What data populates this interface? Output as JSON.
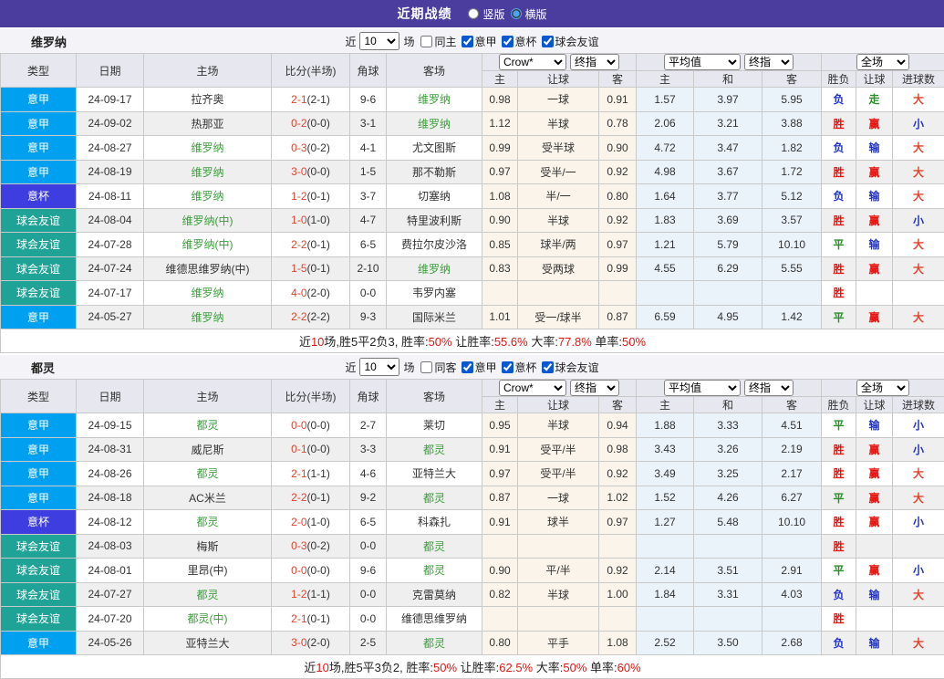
{
  "topbar": {
    "title": "近期战绩",
    "view_options": [
      {
        "label": "竖版",
        "selected": false
      },
      {
        "label": "横版",
        "selected": true
      }
    ]
  },
  "table_header": {
    "left_cols": [
      "类型",
      "日期",
      "主场",
      "比分(半场)",
      "角球",
      "客场"
    ],
    "odds_group_selects": [
      "Crow*",
      "终指"
    ],
    "avg_group_selects": [
      "平均值",
      "终指"
    ],
    "result_group_select": "全场",
    "sub_cols": [
      "主",
      "让球",
      "客",
      "主",
      "和",
      "客",
      "胜负",
      "让球",
      "进球数"
    ]
  },
  "colors": {
    "topbar_bg": "#4a3d9e",
    "header_bg": "#e7e7f0",
    "row_alt_bg": "#efefef",
    "odds_bg": "#fbf4ea",
    "avg_bg": "#eaf2fa",
    "team_highlight": "#3a9e3a",
    "score_red": "#e0442e",
    "league": {
      "意甲": "#00a0f0",
      "意杯": "#3e3ee0",
      "球会友谊": "#1fa396"
    },
    "outcome": {
      "胜": "#e8130f",
      "平": "#2e8b2e",
      "负": "#2233cc"
    },
    "handicap": {
      "赢": "#e8130f",
      "走": "#2e8b2e",
      "输": "#2233cc"
    },
    "goals": {
      "大": "#e0442e",
      "小": "#2233cc"
    }
  },
  "sections": [
    {
      "team": "维罗纳",
      "filter": {
        "prefix": "近",
        "count": "10",
        "suffix": "场",
        "same_venue": {
          "label": "同主",
          "checked": false
        },
        "leagues": [
          {
            "label": "意甲",
            "checked": true
          },
          {
            "label": "意杯",
            "checked": true
          },
          {
            "label": "球会友谊",
            "checked": true
          }
        ]
      },
      "rows": [
        {
          "type": "意甲",
          "date": "24-09-17",
          "home": "拉齐奥",
          "home_hl": false,
          "score": "2-1",
          "half": "(2-1)",
          "corner": "9-6",
          "away": "维罗纳",
          "away_hl": true,
          "odds": [
            "0.98",
            "一球",
            "0.91"
          ],
          "avg": [
            "1.57",
            "3.97",
            "5.95"
          ],
          "result": [
            "负",
            "走",
            "大"
          ]
        },
        {
          "type": "意甲",
          "date": "24-09-02",
          "home": "热那亚",
          "home_hl": false,
          "score": "0-2",
          "half": "(0-0)",
          "corner": "3-1",
          "away": "维罗纳",
          "away_hl": true,
          "odds": [
            "1.12",
            "半球",
            "0.78"
          ],
          "avg": [
            "2.06",
            "3.21",
            "3.88"
          ],
          "result": [
            "胜",
            "赢",
            "小"
          ]
        },
        {
          "type": "意甲",
          "date": "24-08-27",
          "home": "维罗纳",
          "home_hl": true,
          "score": "0-3",
          "half": "(0-2)",
          "corner": "4-1",
          "away": "尤文图斯",
          "away_hl": false,
          "odds": [
            "0.99",
            "受半球",
            "0.90"
          ],
          "avg": [
            "4.72",
            "3.47",
            "1.82"
          ],
          "result": [
            "负",
            "输",
            "大"
          ]
        },
        {
          "type": "意甲",
          "date": "24-08-19",
          "home": "维罗纳",
          "home_hl": true,
          "score": "3-0",
          "half": "(0-0)",
          "corner": "1-5",
          "away": "那不勒斯",
          "away_hl": false,
          "odds": [
            "0.97",
            "受半/一",
            "0.92"
          ],
          "avg": [
            "4.98",
            "3.67",
            "1.72"
          ],
          "result": [
            "胜",
            "赢",
            "大"
          ]
        },
        {
          "type": "意杯",
          "date": "24-08-11",
          "home": "维罗纳",
          "home_hl": true,
          "score": "1-2",
          "half": "(0-1)",
          "corner": "3-7",
          "away": "切塞纳",
          "away_hl": false,
          "odds": [
            "1.08",
            "半/一",
            "0.80"
          ],
          "avg": [
            "1.64",
            "3.77",
            "5.12"
          ],
          "result": [
            "负",
            "输",
            "大"
          ]
        },
        {
          "type": "球会友谊",
          "date": "24-08-04",
          "home": "维罗纳(中)",
          "home_hl": true,
          "score": "1-0",
          "half": "(1-0)",
          "corner": "4-7",
          "away": "特里波利斯",
          "away_hl": false,
          "odds": [
            "0.90",
            "半球",
            "0.92"
          ],
          "avg": [
            "1.83",
            "3.69",
            "3.57"
          ],
          "result": [
            "胜",
            "赢",
            "小"
          ]
        },
        {
          "type": "球会友谊",
          "date": "24-07-28",
          "home": "维罗纳(中)",
          "home_hl": true,
          "score": "2-2",
          "half": "(0-1)",
          "corner": "6-5",
          "away": "费拉尔皮沙洛",
          "away_hl": false,
          "odds": [
            "0.85",
            "球半/两",
            "0.97"
          ],
          "avg": [
            "1.21",
            "5.79",
            "10.10"
          ],
          "result": [
            "平",
            "输",
            "大"
          ]
        },
        {
          "type": "球会友谊",
          "date": "24-07-24",
          "home": "维德思维罗纳(中)",
          "home_hl": false,
          "score": "1-5",
          "half": "(0-1)",
          "corner": "2-10",
          "away": "维罗纳",
          "away_hl": true,
          "odds": [
            "0.83",
            "受两球",
            "0.99"
          ],
          "avg": [
            "4.55",
            "6.29",
            "5.55"
          ],
          "result": [
            "胜",
            "赢",
            "大"
          ]
        },
        {
          "type": "球会友谊",
          "date": "24-07-17",
          "home": "维罗纳",
          "home_hl": true,
          "score": "4-0",
          "half": "(2-0)",
          "corner": "0-0",
          "away": "韦罗内塞",
          "away_hl": false,
          "odds": [
            "",
            "",
            ""
          ],
          "avg": [
            "",
            "",
            ""
          ],
          "result": [
            "胜",
            "",
            ""
          ]
        },
        {
          "type": "意甲",
          "date": "24-05-27",
          "home": "维罗纳",
          "home_hl": true,
          "score": "2-2",
          "half": "(2-2)",
          "corner": "9-3",
          "away": "国际米兰",
          "away_hl": false,
          "odds": [
            "1.01",
            "受一/球半",
            "0.87"
          ],
          "avg": [
            "6.59",
            "4.95",
            "1.42"
          ],
          "result": [
            "平",
            "赢",
            "大"
          ]
        }
      ],
      "summary": [
        {
          "t": "近"
        },
        {
          "t": "10",
          "red": true
        },
        {
          "t": "场,胜5平2负3, 胜率:"
        },
        {
          "t": "50%",
          "red": true
        },
        {
          "t": " 让胜率:"
        },
        {
          "t": "55.6%",
          "red": true
        },
        {
          "t": " 大率:"
        },
        {
          "t": "77.8%",
          "red": true
        },
        {
          "t": " 单率:"
        },
        {
          "t": "50%",
          "red": true
        }
      ]
    },
    {
      "team": "都灵",
      "filter": {
        "prefix": "近",
        "count": "10",
        "suffix": "场",
        "same_venue": {
          "label": "同客",
          "checked": false
        },
        "leagues": [
          {
            "label": "意甲",
            "checked": true
          },
          {
            "label": "意杯",
            "checked": true
          },
          {
            "label": "球会友谊",
            "checked": true
          }
        ]
      },
      "rows": [
        {
          "type": "意甲",
          "date": "24-09-15",
          "home": "都灵",
          "home_hl": true,
          "score": "0-0",
          "half": "(0-0)",
          "corner": "2-7",
          "away": "莱切",
          "away_hl": false,
          "odds": [
            "0.95",
            "半球",
            "0.94"
          ],
          "avg": [
            "1.88",
            "3.33",
            "4.51"
          ],
          "result": [
            "平",
            "输",
            "小"
          ]
        },
        {
          "type": "意甲",
          "date": "24-08-31",
          "home": "威尼斯",
          "home_hl": false,
          "score": "0-1",
          "half": "(0-0)",
          "corner": "3-3",
          "away": "都灵",
          "away_hl": true,
          "odds": [
            "0.91",
            "受平/半",
            "0.98"
          ],
          "avg": [
            "3.43",
            "3.26",
            "2.19"
          ],
          "result": [
            "胜",
            "赢",
            "小"
          ]
        },
        {
          "type": "意甲",
          "date": "24-08-26",
          "home": "都灵",
          "home_hl": true,
          "score": "2-1",
          "half": "(1-1)",
          "corner": "4-6",
          "away": "亚特兰大",
          "away_hl": false,
          "odds": [
            "0.97",
            "受平/半",
            "0.92"
          ],
          "avg": [
            "3.49",
            "3.25",
            "2.17"
          ],
          "result": [
            "胜",
            "赢",
            "大"
          ]
        },
        {
          "type": "意甲",
          "date": "24-08-18",
          "home": "AC米兰",
          "home_hl": false,
          "score": "2-2",
          "half": "(0-1)",
          "corner": "9-2",
          "away": "都灵",
          "away_hl": true,
          "odds": [
            "0.87",
            "一球",
            "1.02"
          ],
          "avg": [
            "1.52",
            "4.26",
            "6.27"
          ],
          "result": [
            "平",
            "赢",
            "大"
          ]
        },
        {
          "type": "意杯",
          "date": "24-08-12",
          "home": "都灵",
          "home_hl": true,
          "score": "2-0",
          "half": "(1-0)",
          "corner": "6-5",
          "away": "科森扎",
          "away_hl": false,
          "odds": [
            "0.91",
            "球半",
            "0.97"
          ],
          "avg": [
            "1.27",
            "5.48",
            "10.10"
          ],
          "result": [
            "胜",
            "赢",
            "小"
          ]
        },
        {
          "type": "球会友谊",
          "date": "24-08-03",
          "home": "梅斯",
          "home_hl": false,
          "score": "0-3",
          "half": "(0-2)",
          "corner": "0-0",
          "away": "都灵",
          "away_hl": true,
          "odds": [
            "",
            "",
            ""
          ],
          "avg": [
            "",
            "",
            ""
          ],
          "result": [
            "胜",
            "",
            ""
          ]
        },
        {
          "type": "球会友谊",
          "date": "24-08-01",
          "home": "里昂(中)",
          "home_hl": false,
          "score": "0-0",
          "half": "(0-0)",
          "corner": "9-6",
          "away": "都灵",
          "away_hl": true,
          "odds": [
            "0.90",
            "平/半",
            "0.92"
          ],
          "avg": [
            "2.14",
            "3.51",
            "2.91"
          ],
          "result": [
            "平",
            "赢",
            "小"
          ]
        },
        {
          "type": "球会友谊",
          "date": "24-07-27",
          "home": "都灵",
          "home_hl": true,
          "score": "1-2",
          "half": "(1-1)",
          "corner": "0-0",
          "away": "克雷莫纳",
          "away_hl": false,
          "odds": [
            "0.82",
            "半球",
            "1.00"
          ],
          "avg": [
            "1.84",
            "3.31",
            "4.03"
          ],
          "result": [
            "负",
            "输",
            "大"
          ]
        },
        {
          "type": "球会友谊",
          "date": "24-07-20",
          "home": "都灵(中)",
          "home_hl": true,
          "score": "2-1",
          "half": "(0-1)",
          "corner": "0-0",
          "away": "维德思维罗纳",
          "away_hl": false,
          "odds": [
            "",
            "",
            ""
          ],
          "avg": [
            "",
            "",
            ""
          ],
          "result": [
            "胜",
            "",
            ""
          ]
        },
        {
          "type": "意甲",
          "date": "24-05-26",
          "home": "亚特兰大",
          "home_hl": false,
          "score": "3-0",
          "half": "(2-0)",
          "corner": "2-5",
          "away": "都灵",
          "away_hl": true,
          "odds": [
            "0.80",
            "平手",
            "1.08"
          ],
          "avg": [
            "2.52",
            "3.50",
            "2.68"
          ],
          "result": [
            "负",
            "输",
            "大"
          ]
        }
      ],
      "summary": [
        {
          "t": "近"
        },
        {
          "t": "10",
          "red": true
        },
        {
          "t": "场,胜5平3负2, 胜率:"
        },
        {
          "t": "50%",
          "red": true
        },
        {
          "t": " 让胜率:"
        },
        {
          "t": "62.5%",
          "red": true
        },
        {
          "t": " 大率:"
        },
        {
          "t": "50%",
          "red": true
        },
        {
          "t": " 单率:"
        },
        {
          "t": "60%",
          "red": true
        }
      ]
    }
  ]
}
